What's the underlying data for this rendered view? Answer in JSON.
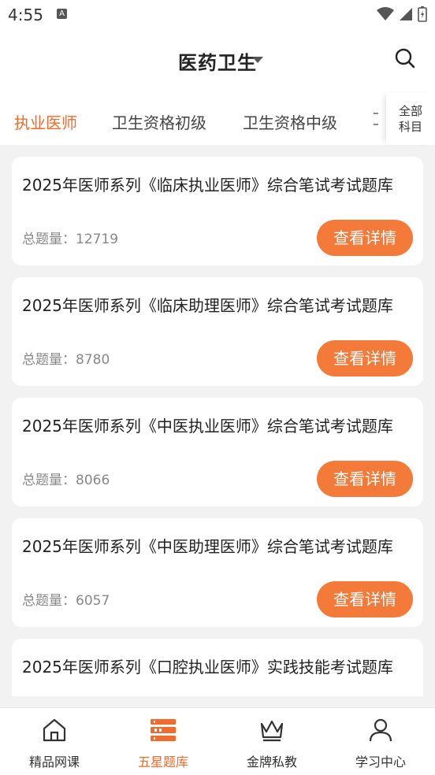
{
  "status_bar": {
    "time": "4:55",
    "notification_badge": "A"
  },
  "header": {
    "title": "医药卫生"
  },
  "tabs": {
    "items": [
      {
        "label": "执业医师",
        "active": true
      },
      {
        "label": "卫生资格初级",
        "active": false
      },
      {
        "label": "卫生资格中级",
        "active": false
      }
    ],
    "all_subjects": "全部\n科目"
  },
  "cards": [
    {
      "title": "2025年医师系列《临床执业医师》综合笔试考试题库",
      "count_label": "总题量：",
      "count": "12719",
      "button": "查看详情"
    },
    {
      "title": "2025年医师系列《临床助理医师》综合笔试考试题库",
      "count_label": "总题量：",
      "count": "8780",
      "button": "查看详情"
    },
    {
      "title": "2025年医师系列《中医执业医师》综合笔试考试题库",
      "count_label": "总题量：",
      "count": "8066",
      "button": "查看详情"
    },
    {
      "title": "2025年医师系列《中医助理医师》综合笔试考试题库",
      "count_label": "总题量：",
      "count": "6057",
      "button": "查看详情"
    },
    {
      "title": "2025年医师系列《口腔执业医师》实践技能考试题库",
      "count_label": "",
      "count": "",
      "button": ""
    }
  ],
  "bottom_nav": [
    {
      "label": "精品网课",
      "icon": "home-icon",
      "active": false
    },
    {
      "label": "五星题库",
      "icon": "question-bank-icon",
      "active": true
    },
    {
      "label": "金牌私教",
      "icon": "crown-icon",
      "active": false
    },
    {
      "label": "学习中心",
      "icon": "user-icon",
      "active": false
    }
  ],
  "colors": {
    "accent": "#f26b2a",
    "button": "#f47a3a"
  }
}
